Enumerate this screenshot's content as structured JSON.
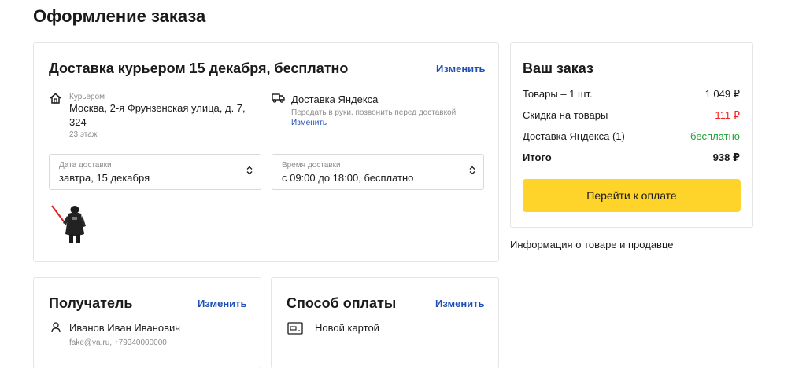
{
  "page": {
    "title": "Оформление заказа"
  },
  "delivery": {
    "title": "Доставка курьером 15 декабря, бесплатно",
    "change_label": "Изменить",
    "address": {
      "type_label": "Курьером",
      "line1": "Москва, 2-я Фрунзенская улица, д. 7,",
      "line2": "324",
      "floor": "23 этаж"
    },
    "service": {
      "name": "Доставка Яндекса",
      "note": "Передать в руки, позвонить перед доставкой",
      "change_label": "Изменить"
    },
    "date_select": {
      "label": "Дата доставки",
      "value": "завтра, 15 декабря"
    },
    "time_select": {
      "label": "Время доставки",
      "value": "с 09:00 до 18:00, бесплатно"
    }
  },
  "recipient": {
    "title": "Получатель",
    "change_label": "Изменить",
    "name": "Иванов Иван Иванович",
    "contacts": "fake@ya.ru, +79340000000"
  },
  "payment": {
    "title": "Способ оплаты",
    "change_label": "Изменить",
    "method": "Новой картой"
  },
  "order": {
    "title": "Ваш заказ",
    "rows": {
      "goods": {
        "label": "Товары – 1 шт.",
        "value": "1 049 ₽"
      },
      "discount": {
        "label": "Скидка на товары",
        "value": "−111 ₽"
      },
      "shipping": {
        "label": "Доставка Яндекса (1)",
        "value": "бесплатно"
      },
      "total": {
        "label": "Итого",
        "value": "938 ₽"
      }
    },
    "pay_button": "Перейти к оплате"
  },
  "info_link": "Информация о товаре и продавце",
  "colors": {
    "accent_yellow": "#fed42b",
    "link_blue": "#1f4fb5",
    "discount_red": "#f0241f",
    "free_green": "#21a038"
  },
  "icons": [
    "home-icon",
    "truck-icon",
    "chevron-updown-icon",
    "person-icon",
    "card-icon"
  ],
  "product_image": "darth-vader-figure"
}
